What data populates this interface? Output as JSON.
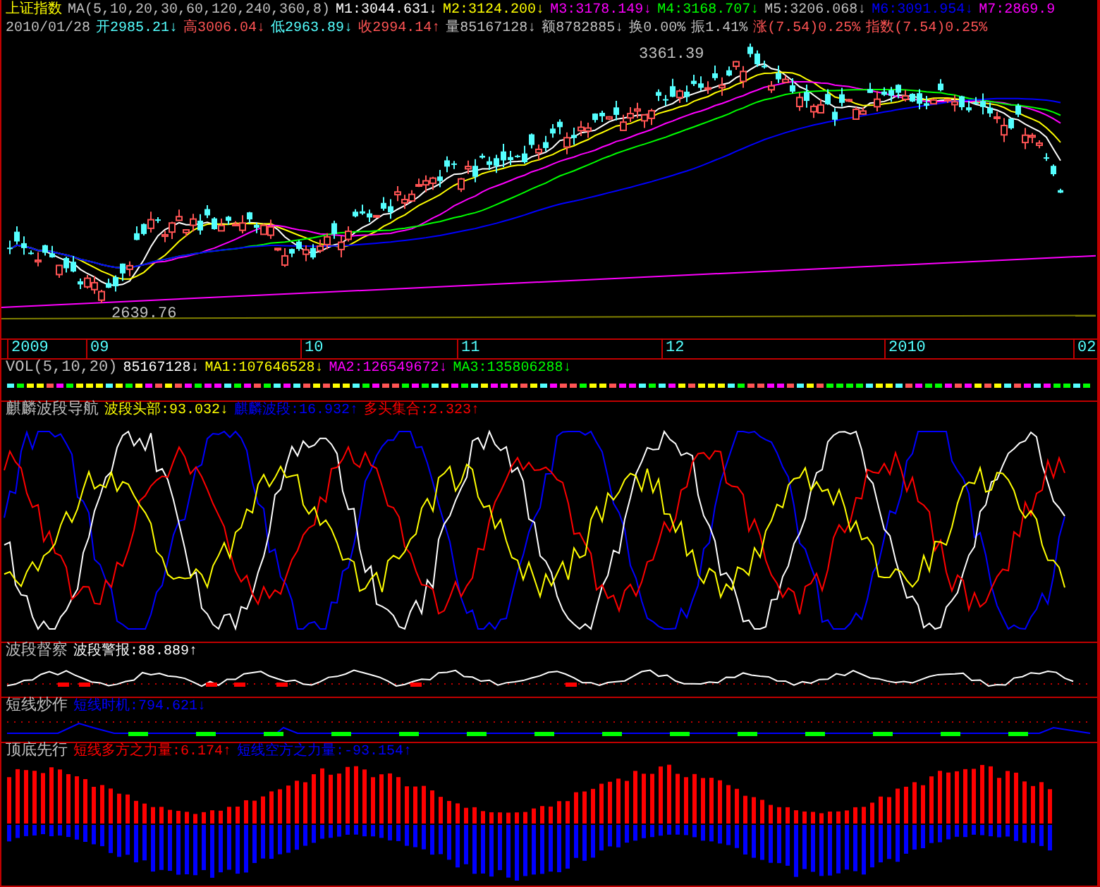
{
  "main_chart": {
    "header": [
      {
        "text": "上证指数",
        "color": "#ffff00"
      },
      {
        "text": "MA(5,10,20,30,60,120,240,360,8)",
        "color": "#c0c0c0"
      },
      {
        "text": "M1:3044.631↓",
        "color": "#ffffff"
      },
      {
        "text": "M2:3124.200↓",
        "color": "#ffff00"
      },
      {
        "text": "M3:3178.149↓",
        "color": "#ff00ff"
      },
      {
        "text": "M4:3168.707↓",
        "color": "#00ff00"
      },
      {
        "text": "M5:3206.068↓",
        "color": "#c0c0c0"
      },
      {
        "text": "M6:3091.954↓",
        "color": "#0000ff"
      },
      {
        "text": "M7:2869.9",
        "color": "#ff00ff"
      }
    ],
    "quote": [
      {
        "text": "2010/01/28",
        "color": "#c0c0c0"
      },
      {
        "text": "开2985.21↓",
        "color": "#54ffff"
      },
      {
        "text": "高3006.04↓",
        "color": "#ff5454"
      },
      {
        "text": "低2963.89↓",
        "color": "#54ffff"
      },
      {
        "text": "收2994.14↑",
        "color": "#ff5454"
      },
      {
        "text": "量85167128↓",
        "color": "#c0c0c0"
      },
      {
        "text": "额8782885↓",
        "color": "#c0c0c0"
      },
      {
        "text": "换0.00%",
        "color": "#c0c0c0"
      },
      {
        "text": "振1.41%",
        "color": "#c0c0c0"
      },
      {
        "text": "涨(7.54)0.25%",
        "color": "#ff5454"
      },
      {
        "text": "指数(7.54)0.25%",
        "color": "#ff5454"
      }
    ],
    "annotations": [
      "3361.39",
      "2639.76"
    ]
  },
  "date_axis": [
    "2009",
    "09",
    "10",
    "11",
    "12",
    "2010",
    "02"
  ],
  "panels": [
    {
      "kind": "volume",
      "title": "VOL(5,10,20)",
      "items": [
        {
          "text": "85167128↓",
          "color": "#ffffff"
        },
        {
          "text": "MA1:107646528↓",
          "color": "#ffff00"
        },
        {
          "text": "MA2:126549672↓",
          "color": "#ff00ff"
        },
        {
          "text": "MA3:135806288↓",
          "color": "#00ff00"
        }
      ]
    },
    {
      "kind": "oscillator",
      "title": "麒麟波段导航",
      "items": [
        {
          "text": "波段头部:93.032↓",
          "color": "#ffff00"
        },
        {
          "text": "麒麟波段:16.932↑",
          "color": "#0000ff"
        },
        {
          "text": "多头集合:2.323↑",
          "color": "#ff0000"
        }
      ]
    },
    {
      "kind": "alarm",
      "title": "波段督察",
      "items": [
        {
          "text": "波段警报:88.889↑",
          "color": "#ffffff"
        }
      ]
    },
    {
      "kind": "timing",
      "title": "短线炒作",
      "items": [
        {
          "text": "短线时机:794.621↓",
          "color": "#0000ff"
        }
      ]
    },
    {
      "kind": "histogram",
      "title": "顶底先行",
      "items": [
        {
          "text": "短线多方之力量:6.174↑",
          "color": "#ff0000"
        },
        {
          "text": "短线空方之力量:-93.154↑",
          "color": "#0000ff"
        }
      ]
    }
  ]
}
